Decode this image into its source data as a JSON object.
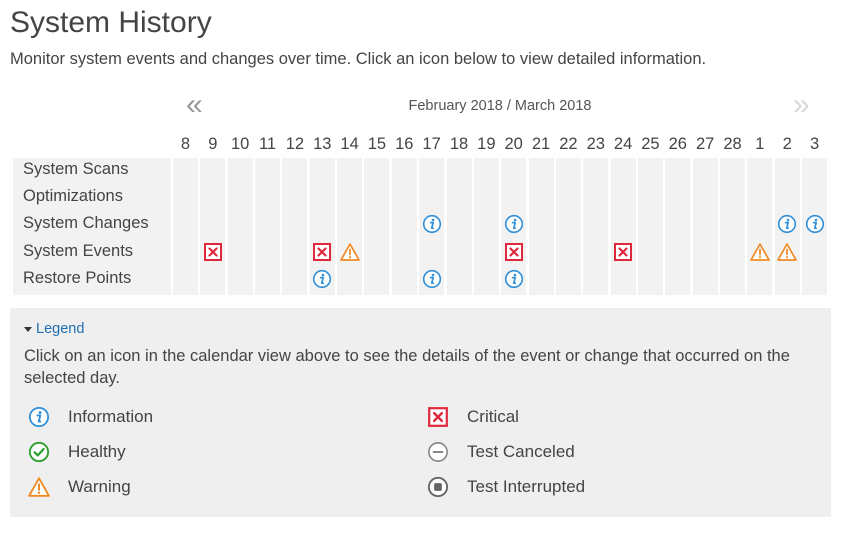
{
  "page": {
    "title": "System History",
    "subtitle": "Monitor system events and changes over time. Click an icon below to view detailed information."
  },
  "calendar": {
    "month_label": "February 2018 / March 2018",
    "prev_glyph": "«",
    "next_glyph": "»",
    "days": [
      "8",
      "9",
      "10",
      "11",
      "12",
      "13",
      "14",
      "15",
      "16",
      "17",
      "18",
      "19",
      "20",
      "21",
      "22",
      "23",
      "24",
      "25",
      "26",
      "27",
      "28",
      "1",
      "2",
      "3"
    ],
    "rows": [
      {
        "label": "System Scans",
        "icons": []
      },
      {
        "label": "Optimizations",
        "icons": []
      },
      {
        "label": "System Changes",
        "icons": [
          {
            "day_index": 9,
            "type": "info"
          },
          {
            "day_index": 12,
            "type": "info"
          },
          {
            "day_index": 22,
            "type": "info"
          },
          {
            "day_index": 23,
            "type": "info"
          }
        ]
      },
      {
        "label": "System Events",
        "icons": [
          {
            "day_index": 1,
            "type": "critical"
          },
          {
            "day_index": 5,
            "type": "critical"
          },
          {
            "day_index": 6,
            "type": "warning"
          },
          {
            "day_index": 12,
            "type": "critical"
          },
          {
            "day_index": 16,
            "type": "critical"
          },
          {
            "day_index": 21,
            "type": "warning"
          },
          {
            "day_index": 22,
            "type": "warning"
          }
        ]
      },
      {
        "label": "Restore Points",
        "icons": [
          {
            "day_index": 5,
            "type": "info"
          },
          {
            "day_index": 9,
            "type": "info"
          },
          {
            "day_index": 12,
            "type": "info"
          }
        ]
      }
    ]
  },
  "legend": {
    "toggle_label": "Legend",
    "description": "Click on an icon in the calendar view above to see the details of the event or change that occurred on the selected day.",
    "items": [
      {
        "type": "info",
        "label": "Information",
        "icon": "info-icon"
      },
      {
        "type": "healthy",
        "label": "Healthy",
        "icon": "healthy-icon"
      },
      {
        "type": "warning",
        "label": "Warning",
        "icon": "warning-icon"
      },
      {
        "type": "critical",
        "label": "Critical",
        "icon": "critical-icon"
      },
      {
        "type": "canceled",
        "label": "Test Canceled",
        "icon": "test-canceled-icon"
      },
      {
        "type": "interrupted",
        "label": "Test Interrupted",
        "icon": "test-interrupted-icon"
      }
    ]
  },
  "colors": {
    "info": "#2f8fd8",
    "healthy": "#2e9e2e",
    "warning": "#f08a24",
    "critical": "#e0283c",
    "neutral": "#888888",
    "interrupted": "#666666",
    "link": "#1f6fb2",
    "cell_bg": "#f2f2f2"
  }
}
